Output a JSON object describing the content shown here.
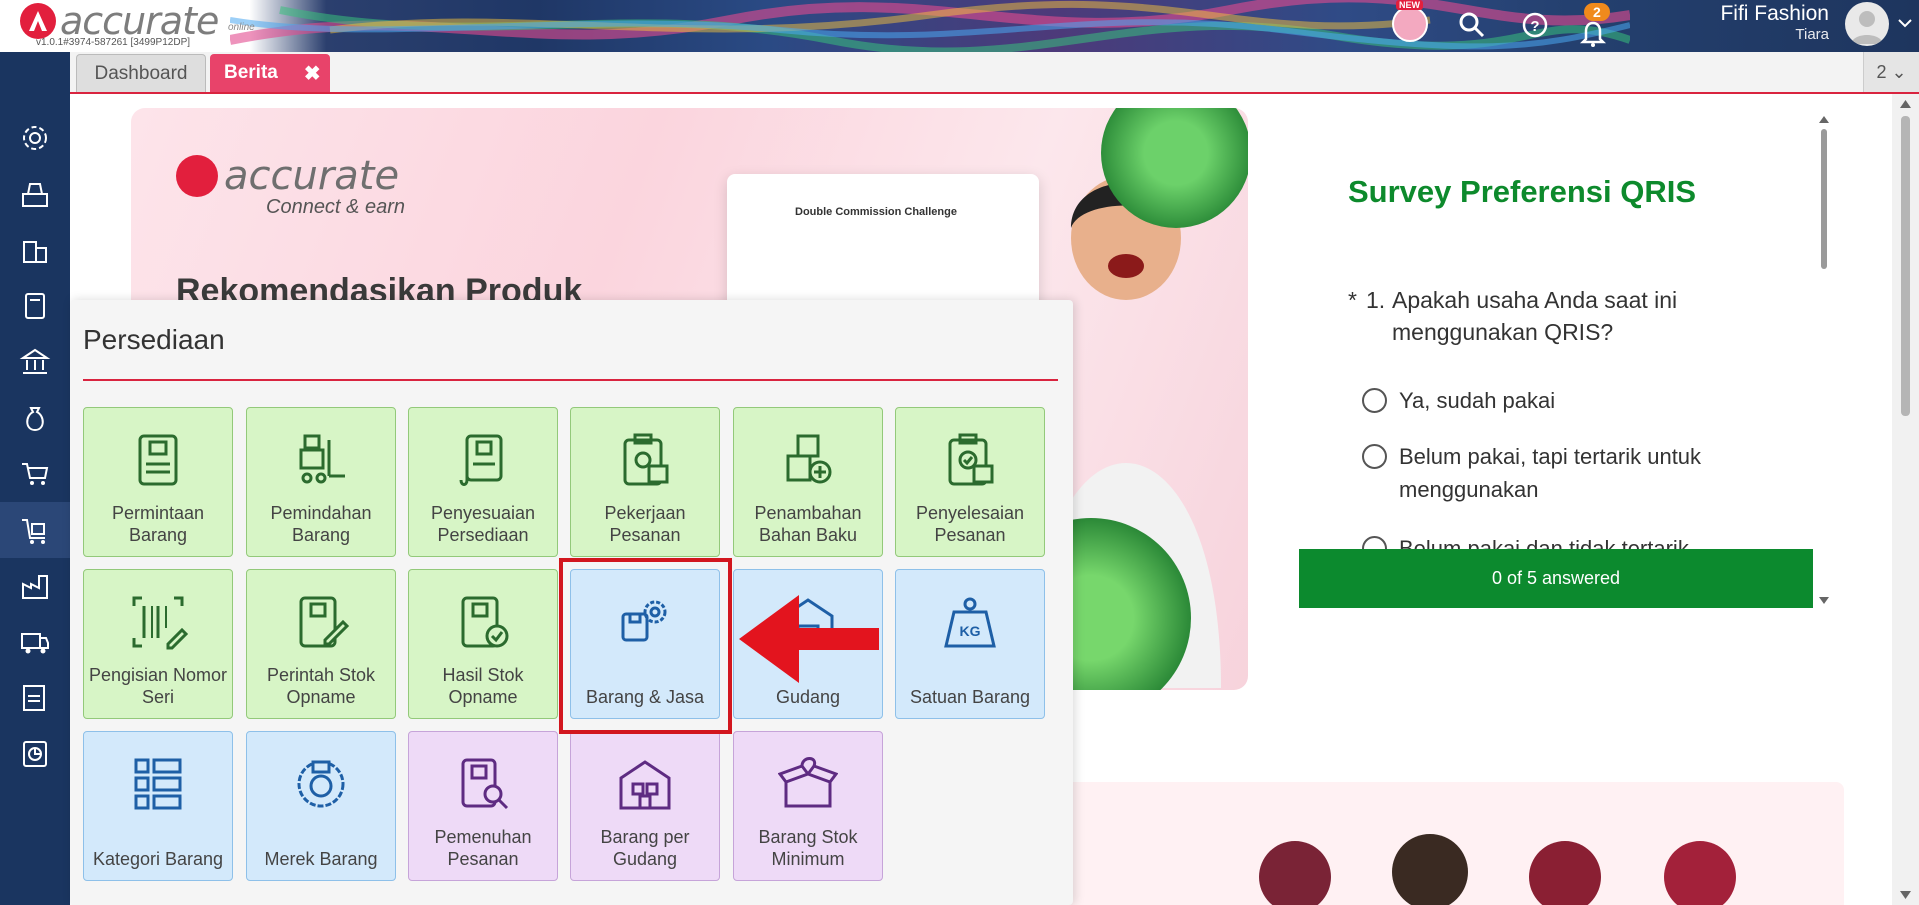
{
  "header": {
    "app_name": "accurate",
    "app_sub": "online",
    "version": "v1.0.1#3974-587261 [3499P12DP]",
    "new_tag": "NEW",
    "notification_count": "2",
    "company_name": "Fifi Fashion",
    "user_name": "Tiara"
  },
  "tabs": [
    {
      "label": "Dashboard"
    },
    {
      "label": "Berita",
      "close": "✖"
    }
  ],
  "tab_count": "2 ⌄",
  "banner": {
    "brand": "accurate",
    "sub": "Connect & earn",
    "headline": "Rekomendasikan Produk",
    "mock_title": "Double Commission Challenge"
  },
  "survey": {
    "title": "Survey Preferensi QRIS",
    "required": "*",
    "number": "1.",
    "question": "Apakah usaha Anda saat ini menggunakan QRIS?",
    "options": [
      "Ya, sudah pakai",
      "Belum pakai, tapi tertarik untuk menggunakan",
      "Belum pakai dan tidak tertarik"
    ],
    "progress": "0 of 5 answered"
  },
  "panel": {
    "title": "Persediaan",
    "tiles": [
      {
        "label": "Permintaan Barang",
        "icon": "document-icon",
        "color": "green"
      },
      {
        "label": "Pemindahan Barang",
        "icon": "forklift-icon",
        "color": "green"
      },
      {
        "label": "Penyesuaian Persediaan",
        "icon": "adjust-doc-icon",
        "color": "green"
      },
      {
        "label": "Pekerjaan Pesanan",
        "icon": "clipboard-gear-icon",
        "color": "green"
      },
      {
        "label": "Penambahan Bahan Baku",
        "icon": "box-plus-icon",
        "color": "green"
      },
      {
        "label": "Penyelesaian Pesanan",
        "icon": "clipboard-check-icon",
        "color": "green"
      },
      {
        "label": "Pengisian Nomor Seri",
        "icon": "barcode-icon",
        "color": "green"
      },
      {
        "label": "Perintah Stok Opname",
        "icon": "doc-pencil-icon",
        "color": "green"
      },
      {
        "label": "Hasil Stok Opname",
        "icon": "doc-check-icon",
        "color": "green"
      },
      {
        "label": "Barang & Jasa",
        "icon": "box-gear-icon",
        "color": "blue"
      },
      {
        "label": "Gudang",
        "icon": "warehouse-icon",
        "color": "blue"
      },
      {
        "label": "Satuan Barang",
        "icon": "weight-icon",
        "color": "blue"
      },
      {
        "label": "Kategori Barang",
        "icon": "category-icon",
        "color": "blue"
      },
      {
        "label": "Merek Barang",
        "icon": "brand-badge-icon",
        "color": "blue"
      },
      {
        "label": "Pemenuhan Pesanan",
        "icon": "doc-search-icon",
        "color": "purple"
      },
      {
        "label": "Barang per Gudang",
        "icon": "warehouse-boxes-icon",
        "color": "purple"
      },
      {
        "label": "Barang Stok Minimum",
        "icon": "open-box-icon",
        "color": "purple"
      }
    ]
  },
  "colors": {
    "accent": "#d9243f",
    "sidebar": "#1a3560",
    "survey_green": "#0c8a2e",
    "highlight": "#d2161e"
  }
}
